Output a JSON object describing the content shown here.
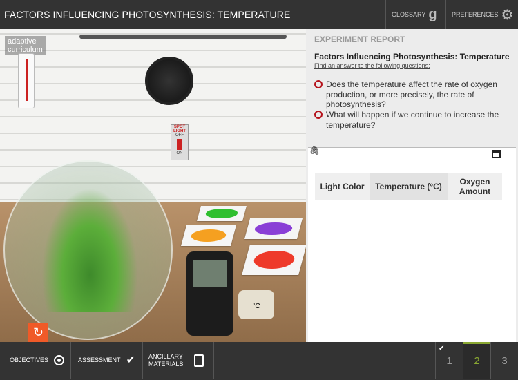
{
  "header": {
    "title": "FACTORS INFLUENCING PHOTOSYNTHESIS: TEMPERATURE",
    "glossary": "GLOSSARY",
    "preferences": "PREFERENCES"
  },
  "scene": {
    "logo_line1": "adaptive",
    "logo_line2": "curriculum",
    "switch_label": "SPOT LIGHT",
    "switch_off": "OFF",
    "switch_on": "ON",
    "probe_unit": "°C",
    "card_colors": [
      "#2fbf2f",
      "#8a3fd6",
      "#f5a020",
      "#ee3a2a"
    ],
    "reset_color": "#f05a28"
  },
  "report": {
    "heading": "EXPERIMENT REPORT",
    "title": "Factors Influencing Photosynthesis: Temperature",
    "subtitle": "Find an answer to the following questions:",
    "questions": [
      "Does the temperature affect the rate of oxygen production, or more precisely, the rate of photosynthesis?",
      "What will happen if we continue to increase the temperature?"
    ],
    "table_headers": [
      "Light Color",
      "Temperature (°C)",
      "Oxygen Amount"
    ]
  },
  "bottom": {
    "objectives": "OBJECTIVES",
    "assessment": "ASSESSMENT",
    "ancillary": "ANCILLARY MATERIALS",
    "pages": [
      "1",
      "2",
      "3"
    ],
    "current_page": "2",
    "accent": "#8aa832"
  }
}
